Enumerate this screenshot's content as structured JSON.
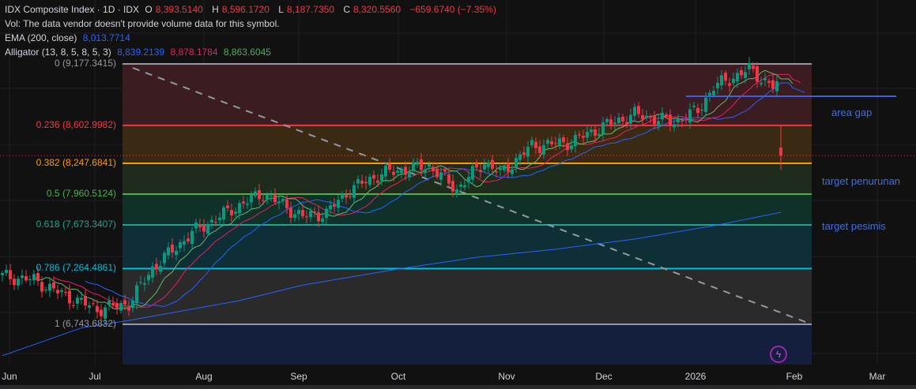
{
  "legend": {
    "symbol": "IDX Composite Index · 1D · IDX",
    "o_label": "O",
    "o": "8,393.5140",
    "h_label": "H",
    "h": "8,596.1720",
    "l_label": "L",
    "l": "8,187.7350",
    "c_label": "C",
    "c": "8,320.5560",
    "change": "−659.6740 (−7.35%)",
    "vol": "Vol: The data vendor doesn't provide volume data for this symbol.",
    "ema_label": "EMA (200, close)",
    "ema_value": "8,013.7714",
    "alligator_label": "Alligator (13, 8, 5, 8, 5, 3)",
    "alligator_jaw": "8,839.2139",
    "alligator_teeth": "8,878.1784",
    "alligator_lips": "8,863.6045"
  },
  "fib_levels": [
    {
      "label": "0 (9,177.3415)",
      "ratio": 0,
      "price": 9177.3415,
      "color": "#9598a1",
      "fill": "#3a1c21"
    },
    {
      "label": "0.236 (8,602.9982)",
      "ratio": 0.236,
      "price": 8602.9982,
      "color": "#f23645",
      "fill": "#3a2a14"
    },
    {
      "label": "0.382 (8,247.6841)",
      "ratio": 0.382,
      "price": 8247.6841,
      "color": "#ff9800",
      "fill": "#1e2c1c"
    },
    {
      "label": "0.5 (7,960.5124)",
      "ratio": 0.5,
      "price": 7960.5124,
      "color": "#4caf50",
      "fill": "#10302a"
    },
    {
      "label": "0.618 (7,673.3407)",
      "ratio": 0.618,
      "price": 7673.3407,
      "color": "#1ea58f",
      "fill": "#0e2f35"
    },
    {
      "label": "0.786 (7,264.4861)",
      "ratio": 0.786,
      "price": 7264.4861,
      "color": "#00bcd4",
      "fill": "#2a2a2b"
    },
    {
      "label": "1 (6,743.6832)",
      "ratio": 1,
      "price": 6743.6832,
      "color": "#9598a1",
      "fill": "#141f3d"
    }
  ],
  "annotations": [
    {
      "text": "area gap"
    },
    {
      "text": "target penurunan"
    },
    {
      "text": "target pesimis"
    }
  ],
  "x_axis": [
    "Jun",
    "Jul",
    "Aug",
    "Sep",
    "Oct",
    "Nov",
    "Dec",
    "2026",
    "Feb",
    "Mar"
  ],
  "colors": {
    "up": "#089981",
    "down": "#f23645",
    "ema": "#2962ff",
    "jaw": "#2962ff",
    "teeth": "#e91e63",
    "lips": "#66bb6a",
    "note": "#3f6fd8"
  },
  "price_path": [
    [
      0,
      7193
    ],
    [
      8,
      7157
    ],
    [
      16,
      7009
    ],
    [
      24,
      6884
    ],
    [
      32,
      6935
    ],
    [
      38,
      7267
    ],
    [
      48,
      7599
    ],
    [
      60,
      7857
    ],
    [
      66,
      7967
    ],
    [
      76,
      7747
    ],
    [
      82,
      7784
    ],
    [
      88,
      8005
    ],
    [
      96,
      8152
    ],
    [
      108,
      8226
    ],
    [
      115,
      8005
    ],
    [
      122,
      8263
    ],
    [
      126,
      8152
    ],
    [
      134,
      8410
    ],
    [
      144,
      8447
    ],
    [
      152,
      8595
    ],
    [
      160,
      8705
    ],
    [
      170,
      8632
    ],
    [
      176,
      8742
    ],
    [
      180,
      8963
    ],
    [
      189,
      9126
    ],
    [
      195,
      8963
    ],
    [
      196,
      8980
    ],
    [
      197,
      8320
    ]
  ],
  "ema200": [
    [
      0,
      6450
    ],
    [
      20,
      6710
    ],
    [
      32,
      6780
    ],
    [
      60,
      6965
    ],
    [
      76,
      7110
    ],
    [
      100,
      7260
    ],
    [
      120,
      7370
    ],
    [
      140,
      7445
    ],
    [
      160,
      7540
    ],
    [
      180,
      7665
    ],
    [
      197,
      7790
    ]
  ],
  "last_price": 8320.556
}
